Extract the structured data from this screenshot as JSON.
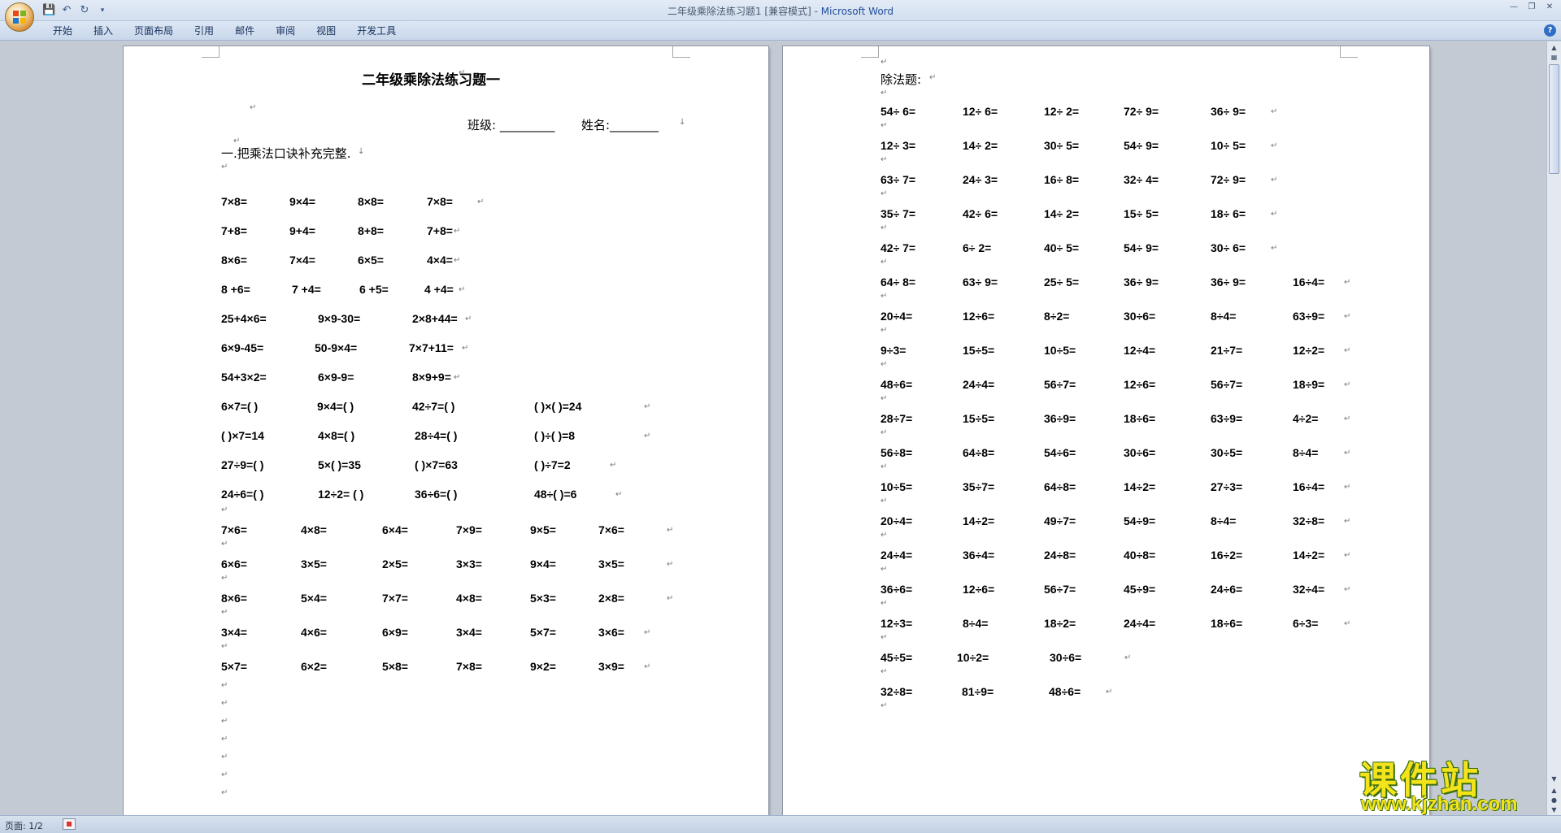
{
  "window": {
    "title": "二年级乘除法练习题1 [兼容模式] - ",
    "app_name": "Microsoft Word"
  },
  "ribbon": {
    "tabs": [
      "开始",
      "插入",
      "页面布局",
      "引用",
      "邮件",
      "审阅",
      "视图",
      "开发工具"
    ]
  },
  "status": {
    "page": "页面: 1/2"
  },
  "watermark": {
    "title": "课件站",
    "url": "www.kjzhan.com"
  },
  "page1": {
    "title": "二年级乘除法练习题一",
    "class_label": "班级: _________",
    "name_label": "姓名:________",
    "section1": "一.把乘法口诀补充完整.",
    "rows": [
      [
        "7×8=",
        "9×4=",
        "8×8=",
        "7×8="
      ],
      [
        "7+8=",
        "9+4=",
        "8+8=",
        "7+8="
      ],
      [
        "8×6=",
        "7×4=",
        "6×5=",
        "4×4="
      ],
      [
        "8 +6=",
        "7 +4=",
        "6 +5=",
        "4 +4="
      ],
      [
        "25+4×6=",
        "9×9-30=",
        "2×8+44="
      ],
      [
        "6×9-45=",
        "50-9×4=",
        "7×7+11="
      ],
      [
        "54+3×2=",
        "6×9-9=",
        "8×9+9="
      ],
      [
        "6×7=(         )",
        "9×4=(         )",
        "42÷7=(         )",
        "(         )×(         )=24"
      ],
      [
        "(         )×7=14",
        "4×8=(         )",
        "28÷4=(         )",
        "(         )÷(         )=8"
      ],
      [
        "27÷9=(         )",
        "5×(         )=35",
        "(         )×7=63",
        "(         )÷7=2"
      ],
      [
        "24÷6=(         )",
        "12÷2= (         )",
        "36÷6=(         )",
        "48÷(         )=6"
      ],
      [
        "7×6=",
        "4×8=",
        "6×4=",
        "7×9=",
        "9×5=",
        "7×6="
      ],
      [
        "6×6=",
        "3×5=",
        "2×5=",
        "3×3=",
        "9×4=",
        "3×5="
      ],
      [
        "8×6=",
        "5×4=",
        "7×7=",
        "4×8=",
        "5×3=",
        "2×8="
      ],
      [
        "3×4=",
        "4×6=",
        "6×9=",
        "3×4=",
        "5×7=",
        "3×6="
      ],
      [
        "5×7=",
        "6×2=",
        "5×8=",
        "7×8=",
        "9×2=",
        "3×9="
      ]
    ]
  },
  "page2": {
    "section": "除法题:",
    "rows": [
      [
        "54÷ 6=",
        "12÷ 6=",
        "12÷ 2=",
        "72÷ 9=",
        "36÷ 9="
      ],
      [
        "12÷ 3=",
        "14÷ 2=",
        "30÷ 5=",
        "54÷ 9=",
        "10÷ 5="
      ],
      [
        "63÷ 7=",
        "24÷ 3=",
        "16÷ 8=",
        "32÷ 4=",
        "72÷ 9="
      ],
      [
        "35÷ 7=",
        "42÷ 6=",
        "14÷ 2=",
        "15÷ 5=",
        "18÷ 6="
      ],
      [
        "42÷ 7=",
        "6÷ 2=",
        "40÷ 5=",
        "54÷ 9=",
        "30÷ 6="
      ],
      [
        "64÷ 8=",
        "63÷ 9=",
        "25÷ 5=",
        "36÷ 9=",
        "36÷ 9=",
        "16÷4="
      ],
      [
        "20÷4=",
        "12÷6=",
        "8÷2=",
        "30÷6=",
        "8÷4=",
        "63÷9="
      ],
      [
        "9÷3=",
        "15÷5=",
        "10÷5=",
        "12÷4=",
        "21÷7=",
        "12÷2="
      ],
      [
        "48÷6=",
        "24÷4=",
        "56÷7=",
        "12÷6=",
        "56÷7=",
        "18÷9="
      ],
      [
        "28÷7=",
        "15÷5=",
        "36÷9=",
        "18÷6=",
        "63÷9=",
        "4÷2="
      ],
      [
        "56÷8=",
        "64÷8=",
        "54÷6=",
        "30÷6=",
        "30÷5=",
        "8÷4="
      ],
      [
        "10÷5=",
        "35÷7=",
        "64÷8=",
        "14÷2=",
        "27÷3=",
        "16÷4="
      ],
      [
        "20÷4=",
        "14÷2=",
        "49÷7=",
        "54÷9=",
        "8÷4=",
        "32÷8="
      ],
      [
        "24÷4=",
        "36÷4=",
        "24÷8=",
        "40÷8=",
        "16÷2=",
        "14÷2="
      ],
      [
        "36÷6=",
        "12÷6=",
        "56÷7=",
        "45÷9=",
        "24÷6=",
        "32÷4="
      ],
      [
        "12÷3=",
        "8÷4=",
        "18÷2=",
        "24÷4=",
        "18÷6=",
        "6÷3="
      ],
      [
        "45÷5=",
        "10÷2=",
        "30÷6="
      ],
      [
        "32÷8=",
        "81÷9=",
        "48÷6="
      ]
    ]
  }
}
